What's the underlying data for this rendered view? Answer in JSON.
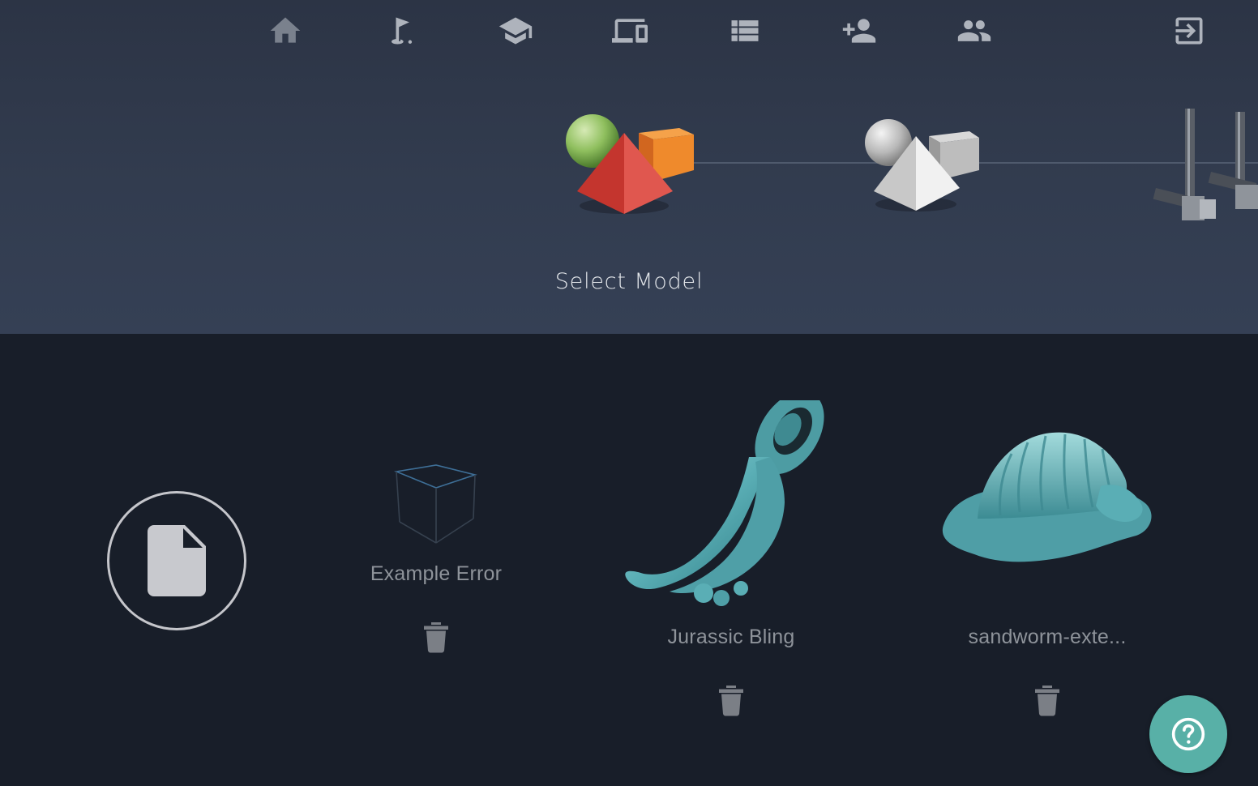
{
  "nav": {
    "items": [
      {
        "name": "home-icon",
        "label": "Home"
      },
      {
        "name": "golf-flag-icon",
        "label": "Getting started"
      },
      {
        "name": "graduation-cap-icon",
        "label": "Learn"
      },
      {
        "name": "devices-icon",
        "label": "Devices"
      },
      {
        "name": "list-icon",
        "label": "Jobs"
      },
      {
        "name": "add-person-icon",
        "label": "Add user"
      },
      {
        "name": "group-icon",
        "label": "Users"
      },
      {
        "name": "exit-icon",
        "label": "Log out"
      }
    ]
  },
  "steps": {
    "active_label": "Select Model",
    "icons": [
      "colored-shapes-icon",
      "gray-shapes-icon",
      "printer-rails-icon"
    ]
  },
  "models": {
    "upload_icon": "file-icon",
    "items": [
      {
        "title": "Example Error",
        "thumbnail": "empty-cube-icon"
      },
      {
        "title": "Jurassic Bling",
        "thumbnail": "jurassic-bling-model"
      },
      {
        "title": "sandworm-exte...",
        "thumbnail": "sandworm-model"
      }
    ],
    "delete_icon": "trash-icon"
  },
  "help": {
    "icon": "question-icon"
  },
  "colors": {
    "header_bg": "#323c4f",
    "body_bg": "#181e29",
    "model_teal": "#5aaeb5",
    "help_teal": "#58b0a7",
    "sphere_green": "#8fbf5e",
    "pyramid_red": "#d8453d",
    "cube_orange": "#ef8a2c"
  }
}
